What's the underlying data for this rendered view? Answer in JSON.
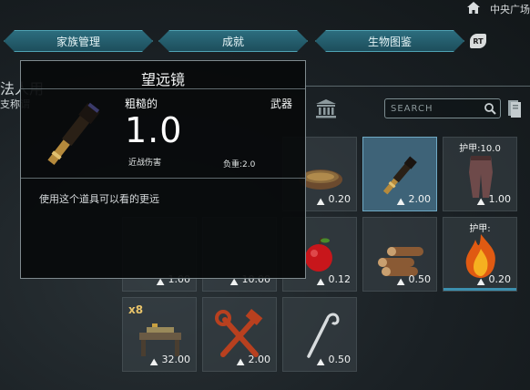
{
  "header": {
    "location": "中央广场"
  },
  "tabs": [
    {
      "label": "家族管理"
    },
    {
      "label": "成就"
    },
    {
      "label": "生物图鉴"
    }
  ],
  "rt_badge": "RT",
  "left_panel": {
    "title": "法人用",
    "subtitle": "支称谓"
  },
  "search": {
    "placeholder": "SEARCH"
  },
  "tooltip": {
    "title": "望远镜",
    "quality": "粗糙的",
    "type": "武器",
    "damage_value": "1.0",
    "damage_label": "近战伤害",
    "load": "负重:2.0",
    "description": "使用这个道具可以看的更远"
  },
  "inventory": [
    {
      "id": "bowl",
      "weight": "0.20",
      "selected": false
    },
    {
      "id": "telescope",
      "weight": "2.00",
      "selected": true
    },
    {
      "id": "pants",
      "weight": "1.00",
      "top_stat": "护甲:10.0",
      "selected": false
    },
    {
      "id": "hidden-1",
      "weight": "1.00"
    },
    {
      "id": "hidden-2",
      "weight": "10.00"
    },
    {
      "id": "apple",
      "weight": "0.12"
    },
    {
      "id": "logs",
      "weight": "0.50"
    },
    {
      "id": "fire-armor",
      "weight": "0.20",
      "top_stat": "护甲:",
      "durability": 1.0
    },
    {
      "id": "table",
      "weight": "32.00",
      "count": "x8"
    },
    {
      "id": "tools",
      "weight": "2.00"
    },
    {
      "id": "hook",
      "weight": "0.50"
    }
  ]
}
